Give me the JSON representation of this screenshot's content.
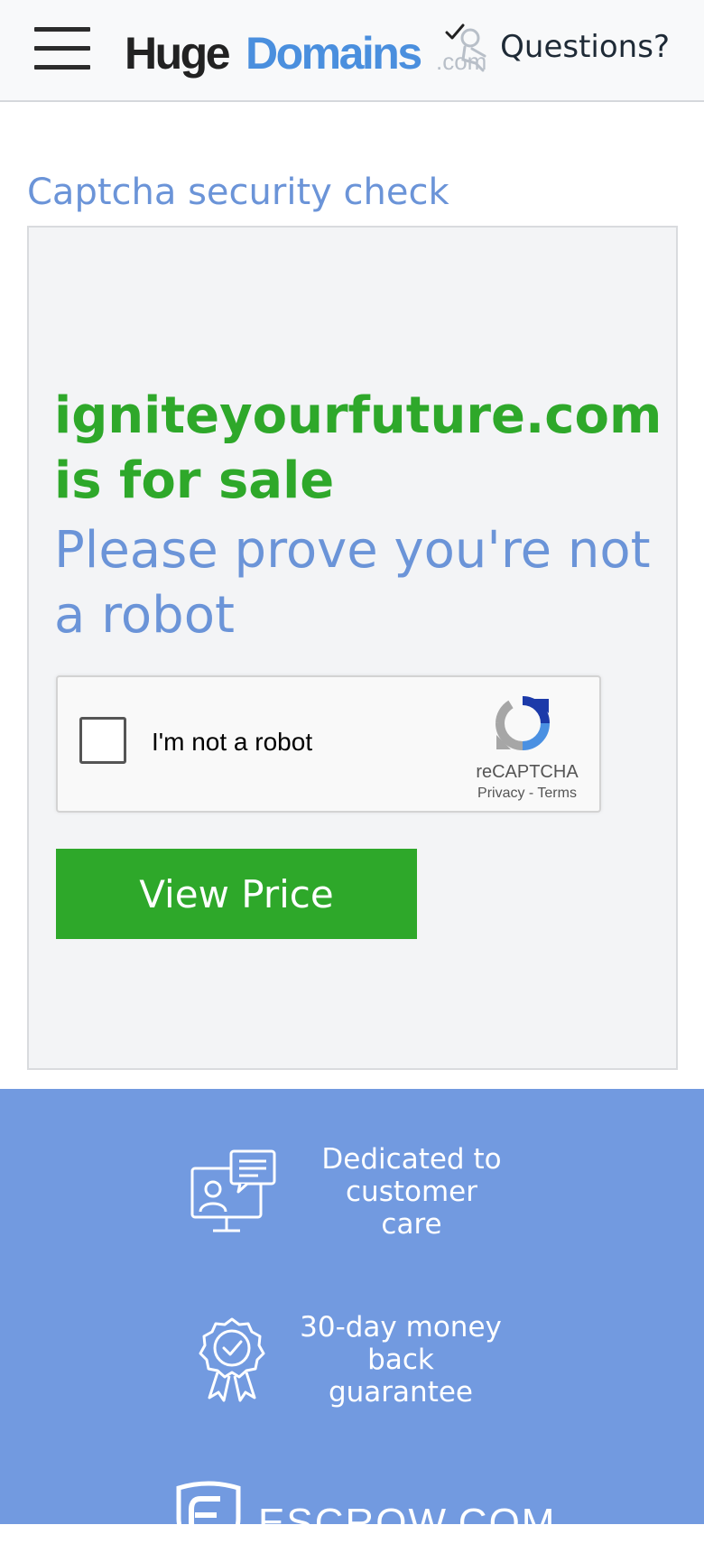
{
  "header": {
    "logo": {
      "part1": "Huge",
      "part2": "Domains",
      "part3": ".com"
    },
    "questions_label": "Questions?"
  },
  "page": {
    "title": "Captcha security check"
  },
  "card": {
    "sale_text": "igniteyourfuture.com is for sale",
    "prove_text": "Please prove you're not a robot",
    "recaptcha": {
      "checkbox_label": "I'm not a robot",
      "brand": "reCAPTCHA",
      "privacy": "Privacy",
      "separator": "-",
      "terms": "Terms"
    },
    "view_price_label": "View Price"
  },
  "footer": {
    "features": [
      {
        "icon": "customer-care-icon",
        "line1": "Dedicated to",
        "line2": "customer care"
      },
      {
        "icon": "award-badge-icon",
        "line1": "30-day money",
        "line2": "back guarantee"
      }
    ],
    "escrow_label": "ESCROW.COM"
  },
  "colors": {
    "brand_blue": "#6b94d8",
    "brand_green": "#2ea82a",
    "footer_blue": "#729ae0"
  }
}
